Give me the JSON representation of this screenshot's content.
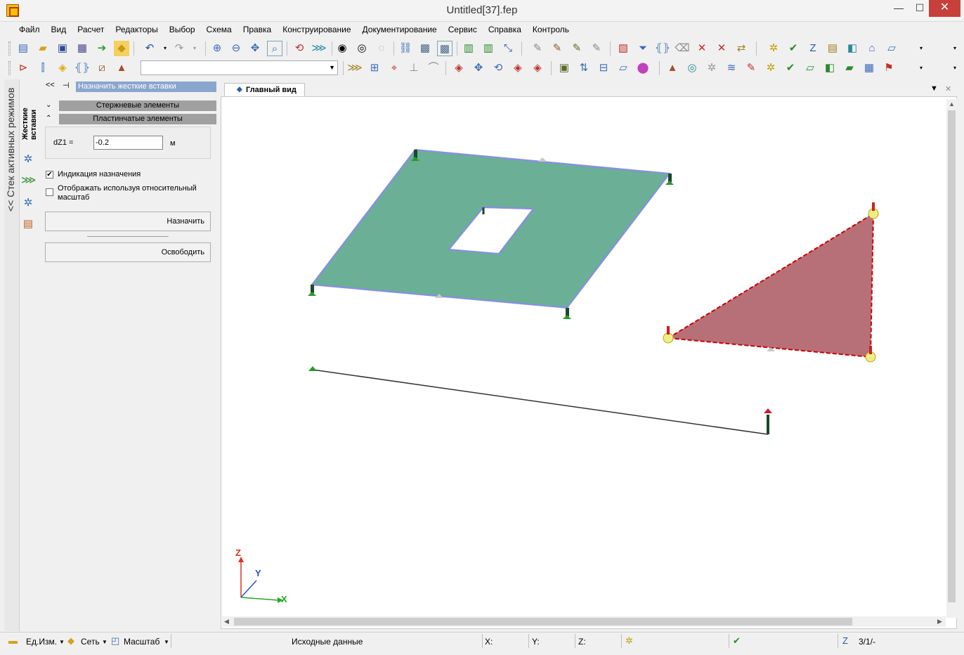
{
  "window": {
    "title": "Untitled[37].fep",
    "minimize_glyph": "—",
    "maximize_glyph": "☐",
    "close_glyph": "✕"
  },
  "menu": [
    {
      "label": "Файл"
    },
    {
      "label": "Вид"
    },
    {
      "label": "Расчет"
    },
    {
      "label": "Редакторы"
    },
    {
      "label": "Выбор"
    },
    {
      "label": "Схема"
    },
    {
      "label": "Правка"
    },
    {
      "label": "Конструирование"
    },
    {
      "label": "Документирование"
    },
    {
      "label": "Сервис"
    },
    {
      "label": "Справка"
    },
    {
      "label": "Контроль"
    }
  ],
  "toolbar": {
    "combo_value": ""
  },
  "left_strip": {
    "stack_label": "<< Стек активных режимов",
    "mode_label": "Жесткие вставки"
  },
  "panel": {
    "collapse_label": "<<",
    "pin_glyph": "⊣",
    "title": "Назначить жесткие вставки",
    "section_bar": "Стержневые элементы",
    "section_plate": "Пластинчатые элементы",
    "dz_label": "dZ1 =",
    "dz_value": "-0.2",
    "dz_unit": "м",
    "check_indication": {
      "label": "Индикация назначения",
      "checked": true
    },
    "check_relative_line1": "Отображать используя относительный",
    "check_relative_line2": "масштаб",
    "check_relative_checked": false,
    "assign_button": "Назначить",
    "release_button": "Освободить"
  },
  "viewport": {
    "tab_label": "Главный вид",
    "axis_x": "X",
    "axis_y": "Y",
    "axis_z": "Z",
    "colors": {
      "plate": "#6aaf96",
      "plate_edge": "#8a8aee",
      "triangle": "#b87078",
      "triangle_edge": "#cc0000",
      "axis_x": "#22aa22",
      "axis_y": "#2a4ecc",
      "axis_z": "#dd3322"
    }
  },
  "statusbar": {
    "units": "Ед.Изм.",
    "grid": "Сеть",
    "scale": "Масштаб",
    "mode": "Исходные данные",
    "x_label": "X:",
    "y_label": "Y:",
    "z_label": "Z:",
    "page": "3/1/-"
  }
}
